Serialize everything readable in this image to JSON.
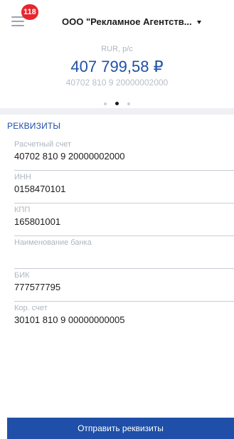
{
  "header": {
    "notification_count": "118",
    "company_name": "ООО \"Рекламное Агентств...",
    "menu_icon": "hamburger-menu-icon",
    "dropdown_icon": "chevron-down-icon"
  },
  "account": {
    "type": "RUR, р/с",
    "balance": "407 799,58 ₽",
    "number": "40702 810 9 20000002000"
  },
  "pager": {
    "total": 3,
    "active_index": 1
  },
  "section_title": "РЕКВИЗИТЫ",
  "fields": [
    {
      "label": "Расчетный счет",
      "value": "40702 810 9 20000002000"
    },
    {
      "label": "ИНН",
      "value": "0158470101"
    },
    {
      "label": "КПП",
      "value": "165801001"
    },
    {
      "label": "Наименование банка",
      "value": ""
    },
    {
      "label": "БИК",
      "value": "777577795"
    },
    {
      "label": "Кор. счет",
      "value": "30101 810 9 00000000005"
    }
  ],
  "send_button": "Отправить реквизиты",
  "colors": {
    "accent": "#1f4fa8",
    "badge": "#e6262e",
    "muted_text": "#aeb6bf"
  }
}
